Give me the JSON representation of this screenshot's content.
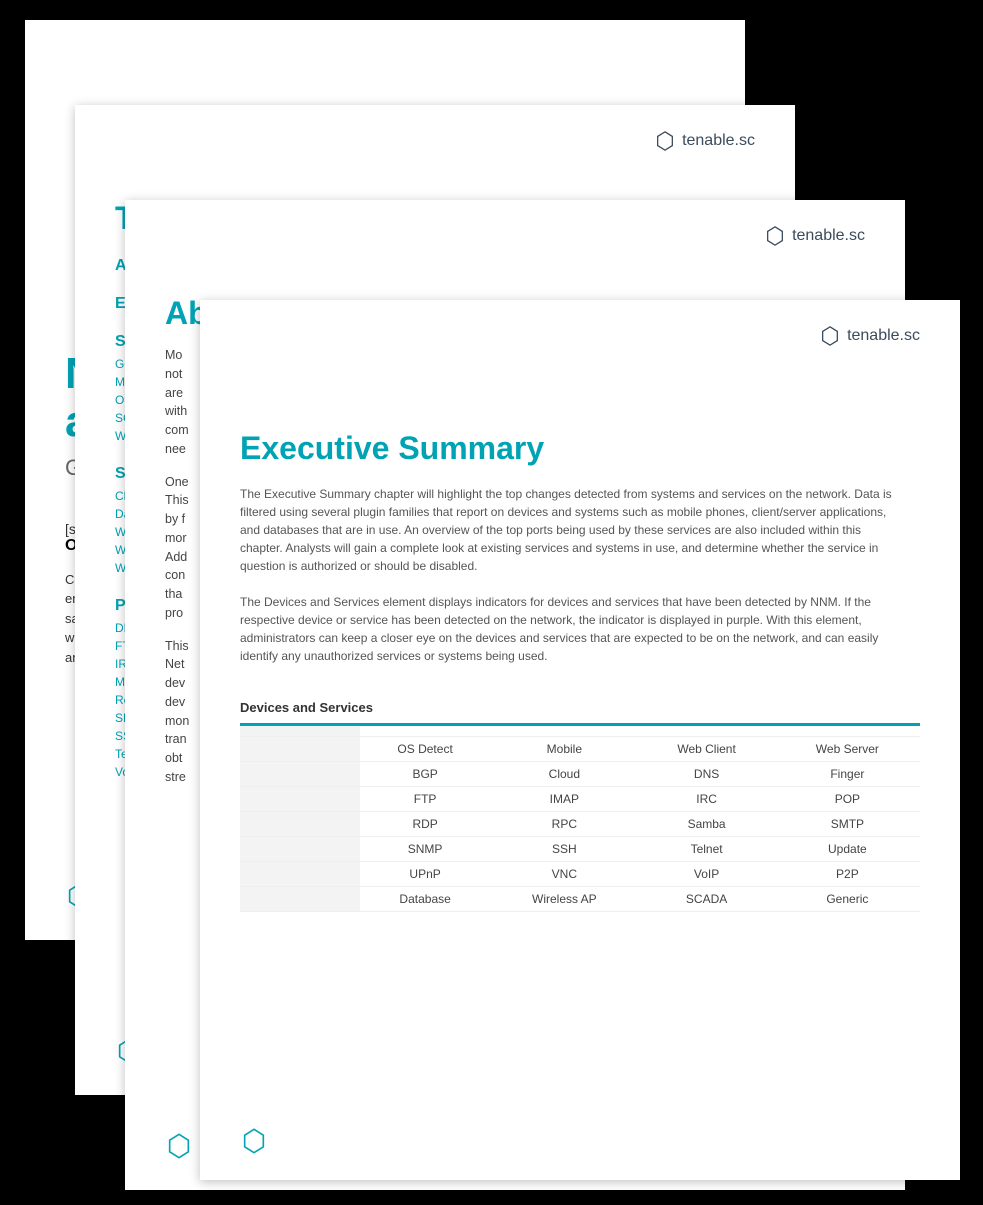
{
  "brand": "tenable.sc",
  "page1": {
    "partial_brand": "tenable.sc",
    "title_line1": "N",
    "title_line2": "a",
    "subtitle": "Ge",
    "sec": "[sec",
    "or": "OR",
    "conf_l1": "Confi",
    "conf_l2": "email",
    "conf_l3": "saved",
    "conf_l4": "within",
    "conf_l5": "any o"
  },
  "page2": {
    "title": "Table of Contents",
    "sect_a": "A",
    "sect_e": "E",
    "sect_s1": "S",
    "s1_items": [
      "Ge",
      "Mo",
      "Op",
      "SC",
      "Wi"
    ],
    "sect_s2": "S",
    "s2_items": [
      "Cl",
      "Da",
      "We",
      "We",
      "We"
    ],
    "sect_p": "P",
    "p_items": [
      "DN",
      "FT",
      "IR",
      "Ma",
      "Re",
      "SN",
      "SS",
      "Te",
      "Vo"
    ]
  },
  "page3": {
    "title": "About This Report",
    "para1_lines": [
      "Mo",
      "not",
      "are",
      "with",
      "com",
      "nee"
    ],
    "para2_lines": [
      "One",
      "This",
      "by f",
      "mor",
      "Add",
      "con",
      "tha",
      "pro"
    ],
    "para3_lines": [
      "This",
      "Net",
      "dev",
      "dev",
      "mon",
      "tran",
      "obt",
      "stre"
    ]
  },
  "page4": {
    "title": "Executive Summary",
    "para1": "The Executive Summary chapter will highlight the top changes detected from systems and services on the network. Data is filtered using several plugin families that report on devices and systems such as mobile phones, client/server applications, and databases that are in use. An overview of the top ports being used by these services are also included within this chapter. Analysts will gain a complete look at existing services and systems in use, and determine whether the service in question is authorized or should be disabled.",
    "para2": "The Devices and Services element displays indicators for devices and services that have been detected by NNM. If the respective device or service has been detected on the network, the indicator is displayed in purple. With this element, administrators can keep a closer eye on the devices and services that are expected to be on the network, and can easily identify any unauthorized services or systems being used.",
    "table_title": "Devices and Services",
    "rows": [
      [
        "OS Detect",
        "Mobile",
        "Web Client",
        "Web Server"
      ],
      [
        "BGP",
        "Cloud",
        "DNS",
        "Finger"
      ],
      [
        "FTP",
        "IMAP",
        "IRC",
        "POP"
      ],
      [
        "RDP",
        "RPC",
        "Samba",
        "SMTP"
      ],
      [
        "SNMP",
        "SSH",
        "Telnet",
        "Update"
      ],
      [
        "UPnP",
        "VNC",
        "VoIP",
        "P2P"
      ],
      [
        "Database",
        "Wireless AP",
        "SCADA",
        "Generic"
      ]
    ]
  }
}
